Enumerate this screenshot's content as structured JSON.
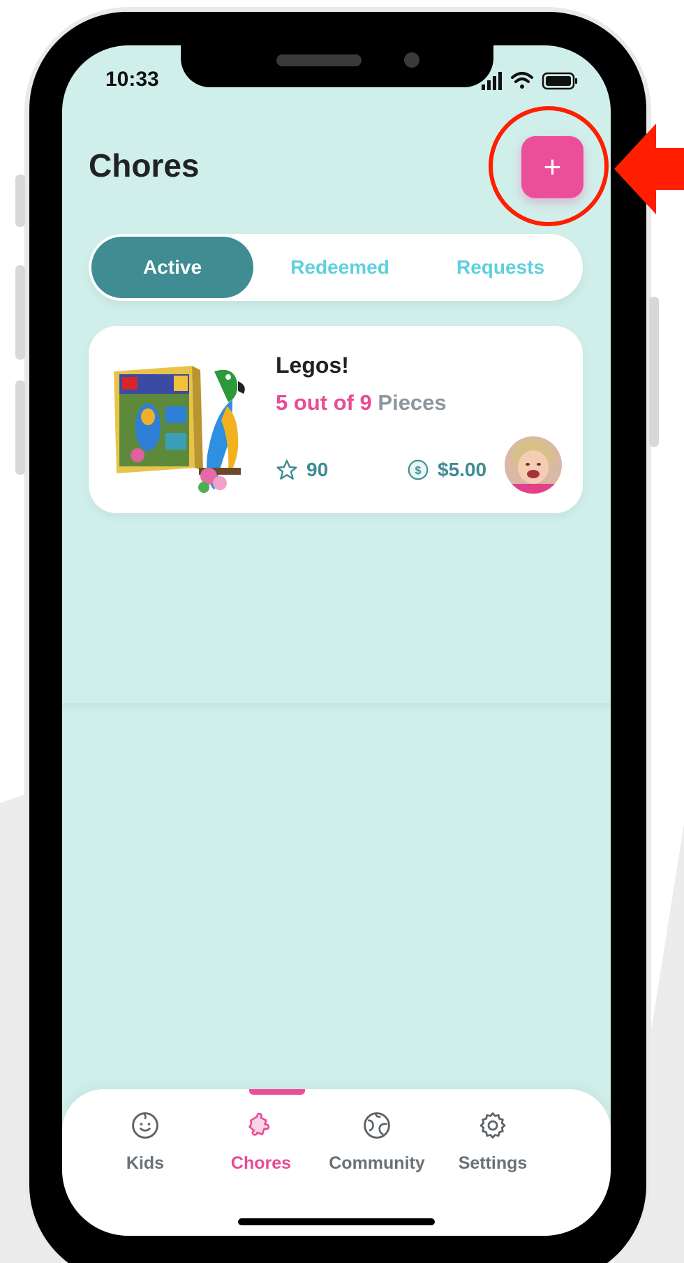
{
  "status_bar": {
    "time": "10:33",
    "icons": [
      "cellular-signal-icon",
      "wifi-icon",
      "battery-icon"
    ]
  },
  "header": {
    "title": "Chores",
    "add_button": "+"
  },
  "tabs": [
    {
      "label": "Active",
      "selected": true
    },
    {
      "label": "Redeemed",
      "selected": false
    },
    {
      "label": "Requests",
      "selected": false
    }
  ],
  "chore_card": {
    "title": "Legos!",
    "progress_count": "5 out of 9",
    "progress_unit": "Pieces",
    "stars": "90",
    "money": "$5.00",
    "image": "lego-parrot-set-image",
    "avatar": "child-avatar"
  },
  "bottom_nav": [
    {
      "label": "Kids",
      "icon": "kid-face-icon",
      "active": false
    },
    {
      "label": "Chores",
      "icon": "puzzle-icon",
      "active": true
    },
    {
      "label": "Community",
      "icon": "globe-icon",
      "active": false
    },
    {
      "label": "Settings",
      "icon": "gear-icon",
      "active": false
    }
  ],
  "colors": {
    "screen_bg": "#d0efea",
    "accent_pink": "#ec4f9a",
    "teal": "#3f8c93",
    "tab_inactive": "#5fd0dd",
    "callout_red": "#ff1e00"
  }
}
